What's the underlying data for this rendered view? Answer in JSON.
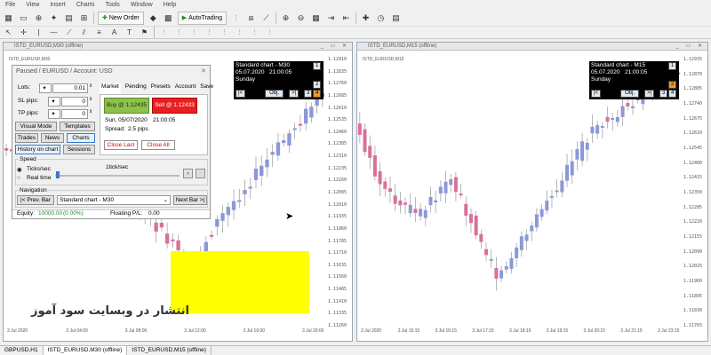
{
  "menu": [
    "File",
    "View",
    "Insert",
    "Charts",
    "Tools",
    "Window",
    "Help"
  ],
  "toolbar": {
    "new_order": "New Order",
    "autotrading": "AutoTrading"
  },
  "left_window": {
    "title": "ISTD_EURUSD,M30 (offline)",
    "symbol_label": "ISTD_EURUSD,M30",
    "prices": [
      "1.12910",
      "1.12835",
      "1.12760",
      "1.12685",
      "1.12610",
      "1.12535",
      "1.12460",
      "1.12385",
      "1.12310",
      "1.12235",
      "1.12160",
      "1.12085",
      "1.12010",
      "1.11935",
      "1.11860",
      "1.11785",
      "1.11710",
      "1.11635",
      "1.11560",
      "1.11485",
      "1.11410",
      "1.11335",
      "1.11260"
    ],
    "current_price": "1.12435",
    "times": [
      "3 Jul 2020",
      "3 Jul 04:00",
      "3 Jul 08:00",
      "3 Jul 12:00",
      "3 Jul 16:00",
      "3 Jul 20:00"
    ],
    "hud": {
      "line1": "Standard chart - M30",
      "date": "05.07.2020",
      "time": "21:00:05",
      "day": "Sunday",
      "b1": "1",
      "b2": "2",
      "b3": "3",
      "b4": "4",
      "left": "|<",
      "obj": "Obj.",
      "right": ">|"
    }
  },
  "right_window": {
    "title": "ISTD_EURUSD,M15 (offline)",
    "symbol_label": "ISTD_EURUSD,M15",
    "prices": [
      "1.12935",
      "1.12870",
      "1.12805",
      "1.12740",
      "1.12675",
      "1.12610",
      "1.12545",
      "1.12480",
      "1.12415",
      "1.12350",
      "1.12285",
      "1.12220",
      "1.12155",
      "1.12090",
      "1.12025",
      "1.11960",
      "1.11895",
      "1.11830",
      "1.11765"
    ],
    "current_price": "1.12435",
    "times": [
      "3 Jul 2020",
      "3 Jul 15:15",
      "3 Jul 16:15",
      "3 Jul 17:15",
      "3 Jul 18:15",
      "3 Jul 19:15",
      "3 Jul 20:15",
      "3 Jul 21:15",
      "3 Jul 23:15"
    ],
    "hud": {
      "line1": "Standard chart - M15",
      "date": "05.07.2020",
      "time": "21:00:05",
      "day": "Sunday",
      "b1": "1",
      "b2": "2",
      "b3": "3",
      "b4": "4",
      "left": "|<",
      "obj": "Obj.",
      "right": ">|"
    }
  },
  "tester": {
    "header": "Paused / EURUSD / Account: USD",
    "lots_label": "Lots:",
    "lots_value": "0.01",
    "sl_label": "SL pips:",
    "sl_value": "0",
    "tp_label": "TP pips:",
    "tp_value": "0",
    "visual_mode": "Visual Mode",
    "templates": "Templates",
    "trades": "Trades",
    "news": "News",
    "charts": "Charts",
    "history_on_chart": "History on chart",
    "sessions": "Sessions",
    "tabs": [
      "Market",
      "Pending",
      "Presets",
      "Account",
      "Save"
    ],
    "buy": "Buy @ 1.12435",
    "sell": "Sell @ 1.12433",
    "date_line": "Sun, 05/07/2020",
    "time_value": "21:00:05",
    "spread": "Spread:",
    "spread_value": "2.5 pips",
    "close_last": "Close Last",
    "close_all": "Close All",
    "speed_label": "Speed",
    "ticks": "Ticks/sec",
    "realtime": "Real time",
    "tick_value": "1tick/sec",
    "navigation": "Navigation",
    "prev_bar": "|< Prev. Bar",
    "chart_select": "Standard chart - M30",
    "next_bar": "Next Bar >|",
    "equity_label": "Equity:",
    "equity_value": "10000.00",
    "equity_pct": "(0.00%)",
    "floating_label": "Floating P/L:",
    "floating_value": "0.00"
  },
  "watermark": "انتشار در وبسایت سود آموز",
  "bottom_tabs": [
    "GBPUSD,H1",
    "ISTD_EURUSD,M30 (offline)",
    "ISTD_EURUSD,M15 (offline)"
  ],
  "colors": {
    "bull": "#8b98d8",
    "bear": "#d8709a",
    "buy": "#8ec14c",
    "sell": "#e81f1f",
    "highlight": "#ffff00"
  }
}
